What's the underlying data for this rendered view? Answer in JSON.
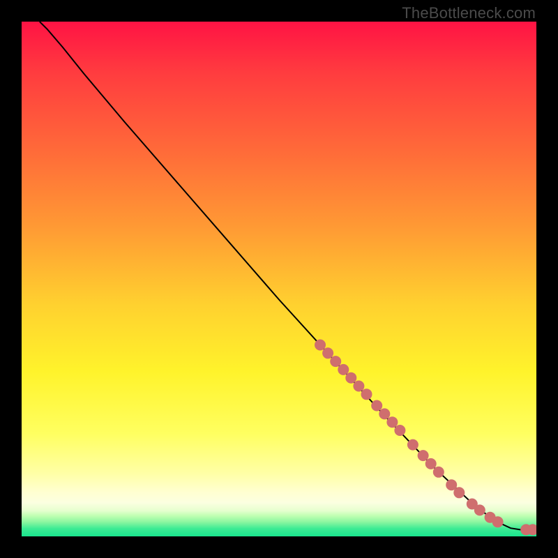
{
  "watermark": "TheBottleneck.com",
  "colors": {
    "background": "#000000",
    "dot": "#cf6e6e",
    "curve": "#000000",
    "gradient_stops": [
      {
        "pos": 0.0,
        "c": "#ff1344"
      },
      {
        "pos": 0.1,
        "c": "#ff3c3f"
      },
      {
        "pos": 0.25,
        "c": "#ff6a39"
      },
      {
        "pos": 0.4,
        "c": "#ff9a34"
      },
      {
        "pos": 0.55,
        "c": "#ffd12f"
      },
      {
        "pos": 0.68,
        "c": "#fff32b"
      },
      {
        "pos": 0.8,
        "c": "#ffff60"
      },
      {
        "pos": 0.88,
        "c": "#ffffa8"
      },
      {
        "pos": 0.915,
        "c": "#ffffd2"
      },
      {
        "pos": 0.935,
        "c": "#fbffe0"
      },
      {
        "pos": 0.95,
        "c": "#e6ffcf"
      },
      {
        "pos": 0.96,
        "c": "#c0ffb2"
      },
      {
        "pos": 0.972,
        "c": "#8cf6a0"
      },
      {
        "pos": 0.985,
        "c": "#3ceb94"
      },
      {
        "pos": 1.0,
        "c": "#19e58e"
      }
    ]
  },
  "chart_data": {
    "type": "line",
    "title": "",
    "xlabel": "",
    "ylabel": "",
    "x_range": [
      0,
      100
    ],
    "y_range": [
      0,
      100
    ],
    "curve": [
      {
        "x": 3.5,
        "y": 100.0
      },
      {
        "x": 5.0,
        "y": 98.5
      },
      {
        "x": 8.0,
        "y": 95.0
      },
      {
        "x": 12.0,
        "y": 90.0
      },
      {
        "x": 20.0,
        "y": 80.5
      },
      {
        "x": 30.0,
        "y": 69.0
      },
      {
        "x": 40.0,
        "y": 57.5
      },
      {
        "x": 50.0,
        "y": 46.0
      },
      {
        "x": 60.0,
        "y": 35.0
      },
      {
        "x": 70.0,
        "y": 24.0
      },
      {
        "x": 80.0,
        "y": 13.5
      },
      {
        "x": 88.0,
        "y": 6.0
      },
      {
        "x": 92.0,
        "y": 3.0
      },
      {
        "x": 95.0,
        "y": 1.6
      },
      {
        "x": 97.5,
        "y": 1.2
      },
      {
        "x": 100.0,
        "y": 1.3
      }
    ],
    "highlighted_points": [
      {
        "x": 58.0,
        "y": 37.2
      },
      {
        "x": 59.5,
        "y": 35.6
      },
      {
        "x": 61.0,
        "y": 34.0
      },
      {
        "x": 62.5,
        "y": 32.4
      },
      {
        "x": 64.0,
        "y": 30.8
      },
      {
        "x": 65.5,
        "y": 29.2
      },
      {
        "x": 67.0,
        "y": 27.6
      },
      {
        "x": 69.0,
        "y": 25.4
      },
      {
        "x": 70.5,
        "y": 23.8
      },
      {
        "x": 72.0,
        "y": 22.2
      },
      {
        "x": 73.5,
        "y": 20.6
      },
      {
        "x": 76.0,
        "y": 17.8
      },
      {
        "x": 78.0,
        "y": 15.7
      },
      {
        "x": 79.5,
        "y": 14.1
      },
      {
        "x": 81.0,
        "y": 12.5
      },
      {
        "x": 83.5,
        "y": 10.0
      },
      {
        "x": 85.0,
        "y": 8.5
      },
      {
        "x": 87.5,
        "y": 6.3
      },
      {
        "x": 89.0,
        "y": 5.1
      },
      {
        "x": 91.0,
        "y": 3.7
      },
      {
        "x": 92.5,
        "y": 2.8
      },
      {
        "x": 98.0,
        "y": 1.3
      },
      {
        "x": 99.3,
        "y": 1.3
      }
    ]
  }
}
